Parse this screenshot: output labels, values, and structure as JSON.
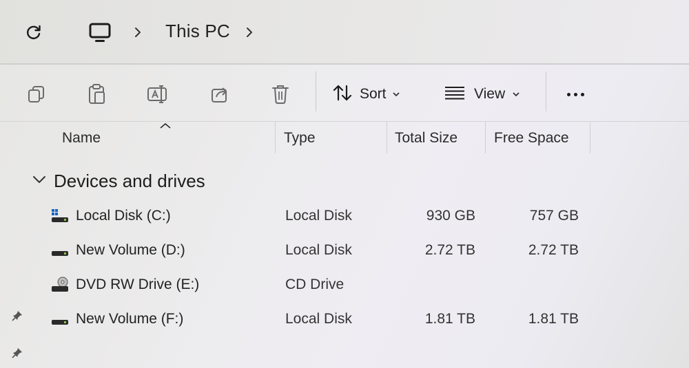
{
  "address_bar": {
    "refresh_icon": "refresh-icon",
    "location_icon": "this-pc-icon",
    "breadcrumb": [
      "This PC"
    ],
    "separator_icon": "chevron-right-icon"
  },
  "command_bar": {
    "icons": [
      "copy-icon",
      "paste-icon",
      "rename-icon",
      "share-icon",
      "delete-icon"
    ],
    "sort_label": "Sort",
    "view_label": "View",
    "more_icon": "more-icon"
  },
  "columns": {
    "name": "Name",
    "type": "Type",
    "total_size": "Total Size",
    "free_space": "Free Space",
    "sorted_column": "name",
    "sort_direction": "ascending"
  },
  "group": {
    "label": "Devices and drives",
    "expanded": true
  },
  "drives": [
    {
      "name": "Local Disk (C:)",
      "type": "Local Disk",
      "total_size": "930 GB",
      "free_space": "757 GB",
      "icon": "system-drive-icon"
    },
    {
      "name": "New Volume (D:)",
      "type": "Local Disk",
      "total_size": "2.72 TB",
      "free_space": "2.72 TB",
      "icon": "drive-icon"
    },
    {
      "name": "DVD RW Drive (E:)",
      "type": "CD Drive",
      "total_size": "",
      "free_space": "",
      "icon": "dvd-drive-icon"
    },
    {
      "name": "New Volume (F:)",
      "type": "Local Disk",
      "total_size": "1.81 TB",
      "free_space": "1.81 TB",
      "icon": "drive-icon"
    }
  ],
  "sidebar_pins": [
    "pin-icon",
    "pin-icon"
  ]
}
